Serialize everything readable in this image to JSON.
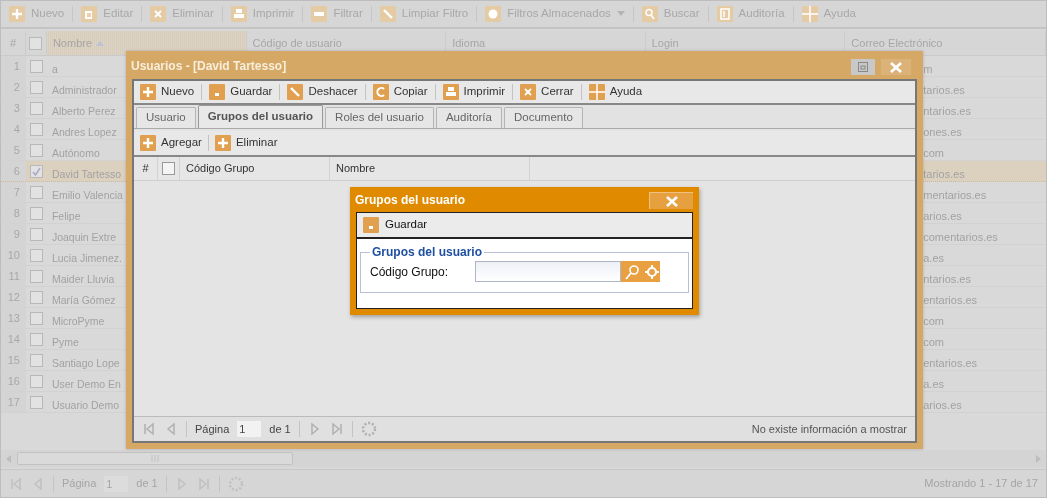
{
  "toolbar": [
    {
      "label": "Nuevo",
      "kind": "button"
    },
    {
      "label": "Editar",
      "kind": "button"
    },
    {
      "label": "Eliminar",
      "kind": "button"
    },
    {
      "label": "Imprimir",
      "kind": "button"
    },
    {
      "label": "Filtrar",
      "kind": "button"
    },
    {
      "label": "Limpiar Filtro",
      "kind": "button"
    },
    {
      "label": "Filtros Almacenados",
      "kind": "menu"
    },
    {
      "label": "Buscar",
      "kind": "button"
    },
    {
      "label": "Auditoría",
      "kind": "button"
    },
    {
      "label": "Ayuda",
      "kind": "button"
    }
  ],
  "grid": {
    "select_all": {
      "checked": false
    },
    "columns": [
      {
        "label": "#",
        "sorted": false
      },
      {
        "label": "Nombre",
        "sorted": true
      },
      {
        "label": "Código de usuario",
        "sorted": false
      },
      {
        "label": "Idioma",
        "sorted": false
      },
      {
        "label": "Login",
        "sorted": false
      },
      {
        "label": "Correo Electrónico",
        "sorted": false
      }
    ],
    "rows": [
      {
        "number": "1",
        "checked": false,
        "selected": false,
        "name": "a",
        "email": "m"
      },
      {
        "number": "2",
        "checked": false,
        "selected": false,
        "name": "Administrador",
        "email": "tarios.es"
      },
      {
        "number": "3",
        "checked": false,
        "selected": false,
        "name": "Alberto Perez",
        "email": "ntarios.es"
      },
      {
        "number": "4",
        "checked": false,
        "selected": false,
        "name": "Andres Lopez",
        "email": "ones.es"
      },
      {
        "number": "5",
        "checked": false,
        "selected": false,
        "name": "Autónomo",
        "email": "com"
      },
      {
        "number": "6",
        "checked": true,
        "selected": true,
        "name": "David Tartesso",
        "email": "tarios.es"
      },
      {
        "number": "7",
        "checked": false,
        "selected": false,
        "name": "Emilio Valencia",
        "email": "mentarios.es"
      },
      {
        "number": "8",
        "checked": false,
        "selected": false,
        "name": "Felipe",
        "email": "arios.es"
      },
      {
        "number": "9",
        "checked": false,
        "selected": false,
        "name": "Joaquin Extre",
        "email": "comentarios.es"
      },
      {
        "number": "10",
        "checked": false,
        "selected": false,
        "name": "Lucia Jimenez.",
        "email": "a.es"
      },
      {
        "number": "11",
        "checked": false,
        "selected": false,
        "name": "Maider Lluvia",
        "email": "ntarios.es"
      },
      {
        "number": "12",
        "checked": false,
        "selected": false,
        "name": "María Gómez",
        "email": "entarios.es"
      },
      {
        "number": "13",
        "checked": false,
        "selected": false,
        "name": "MicroPyme",
        "email": "com"
      },
      {
        "number": "14",
        "checked": false,
        "selected": false,
        "name": "Pyme",
        "email": "com"
      },
      {
        "number": "15",
        "checked": false,
        "selected": false,
        "name": "Santiago Lope",
        "email": "entarios.es"
      },
      {
        "number": "16",
        "checked": false,
        "selected": false,
        "name": "User Demo En",
        "email": "a.es"
      },
      {
        "number": "17",
        "checked": false,
        "selected": false,
        "name": "Usuario Demo",
        "email": "arios.es"
      }
    ],
    "paging": {
      "page_label": "Página",
      "page": "1",
      "of": "de 1",
      "info": "Mostrando 1 - 17 de 17"
    }
  },
  "window": {
    "title": "Usuarios - [David Tartesso]",
    "toolbar": [
      "Nuevo",
      "Guardar",
      "Deshacer",
      "Copiar",
      "Imprimir",
      "Cerrar",
      "Ayuda"
    ],
    "tabs": [
      {
        "label": "Usuario",
        "selected": false
      },
      {
        "label": "Grupos del usuario",
        "selected": true
      },
      {
        "label": "Roles del usuario",
        "selected": false
      },
      {
        "label": "Auditoría",
        "selected": false
      },
      {
        "label": "Documento",
        "selected": false
      }
    ],
    "sub_toolbar": [
      "Agregar",
      "Eliminar"
    ],
    "grid": {
      "select_all": {
        "checked": false
      },
      "columns": [
        "#",
        "Código Grupo",
        "Nombre"
      ]
    },
    "paging": {
      "page_label": "Página",
      "page": "1",
      "of": "de 1",
      "info": "No existe información a mostrar"
    }
  },
  "dialog": {
    "title": "Grupos del usuario",
    "toolbar": [
      "Guardar"
    ],
    "legend": "Grupos del usuario",
    "field_label": "Código Grupo:"
  }
}
